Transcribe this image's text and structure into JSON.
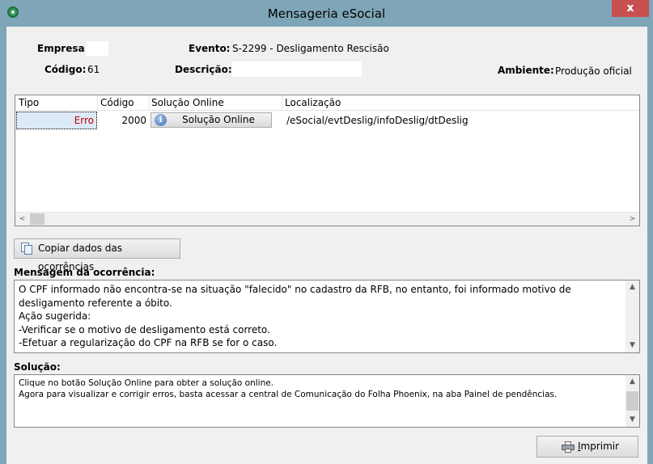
{
  "window": {
    "title": "Mensageria eSocial",
    "close_label": "x"
  },
  "header": {
    "empresa_label": "Empresa:",
    "empresa_value": "",
    "codigo_label": "Código:",
    "codigo_value": "61",
    "evento_label": "Evento:",
    "evento_value": "S-2299 - Desligamento Rescisão",
    "descricao_label": "Descrição:",
    "descricao_value": "",
    "ambiente_label": "Ambiente:",
    "ambiente_value": "Produção oficial"
  },
  "grid": {
    "columns": [
      "Tipo",
      "Código",
      "Solução Online",
      "Localização"
    ],
    "rows": [
      {
        "tipo": "Erro",
        "codigo": "2000",
        "solucao_button": "Solução Online",
        "localizacao": "/eSocial/evtDeslig/infoDeslig/dtDeslig"
      }
    ],
    "scroll_left": "<",
    "scroll_right": ">"
  },
  "copy_button_label": "Copiar dados das ocorrências",
  "mensagem": {
    "label": "Mensagem da ocorrência:",
    "text": "O CPF informado não encontra-se na situação \"falecido\" no cadastro da RFB, no entanto, foi informado motivo de\ndesligamento referente a óbito.\nAção sugerida:\n-Verificar se o motivo de desligamento está correto.\n-Efetuar a regularização do CPF na RFB se for o caso."
  },
  "solucao": {
    "label": "Solução:",
    "text": "Clique no botão Solução Online para obter a solução online.\nAgora para visualizar e corrigir erros, basta acessar a central de Comunicação do Folha Phoenix, na aba Painel de pendências."
  },
  "print_button": {
    "mnemonic": "I",
    "rest": "mprimir"
  },
  "colors": {
    "title_bar": "#7ea6b8",
    "close_button": "#c75050",
    "error_text": "#c00000",
    "selection": "#dce9f7"
  }
}
